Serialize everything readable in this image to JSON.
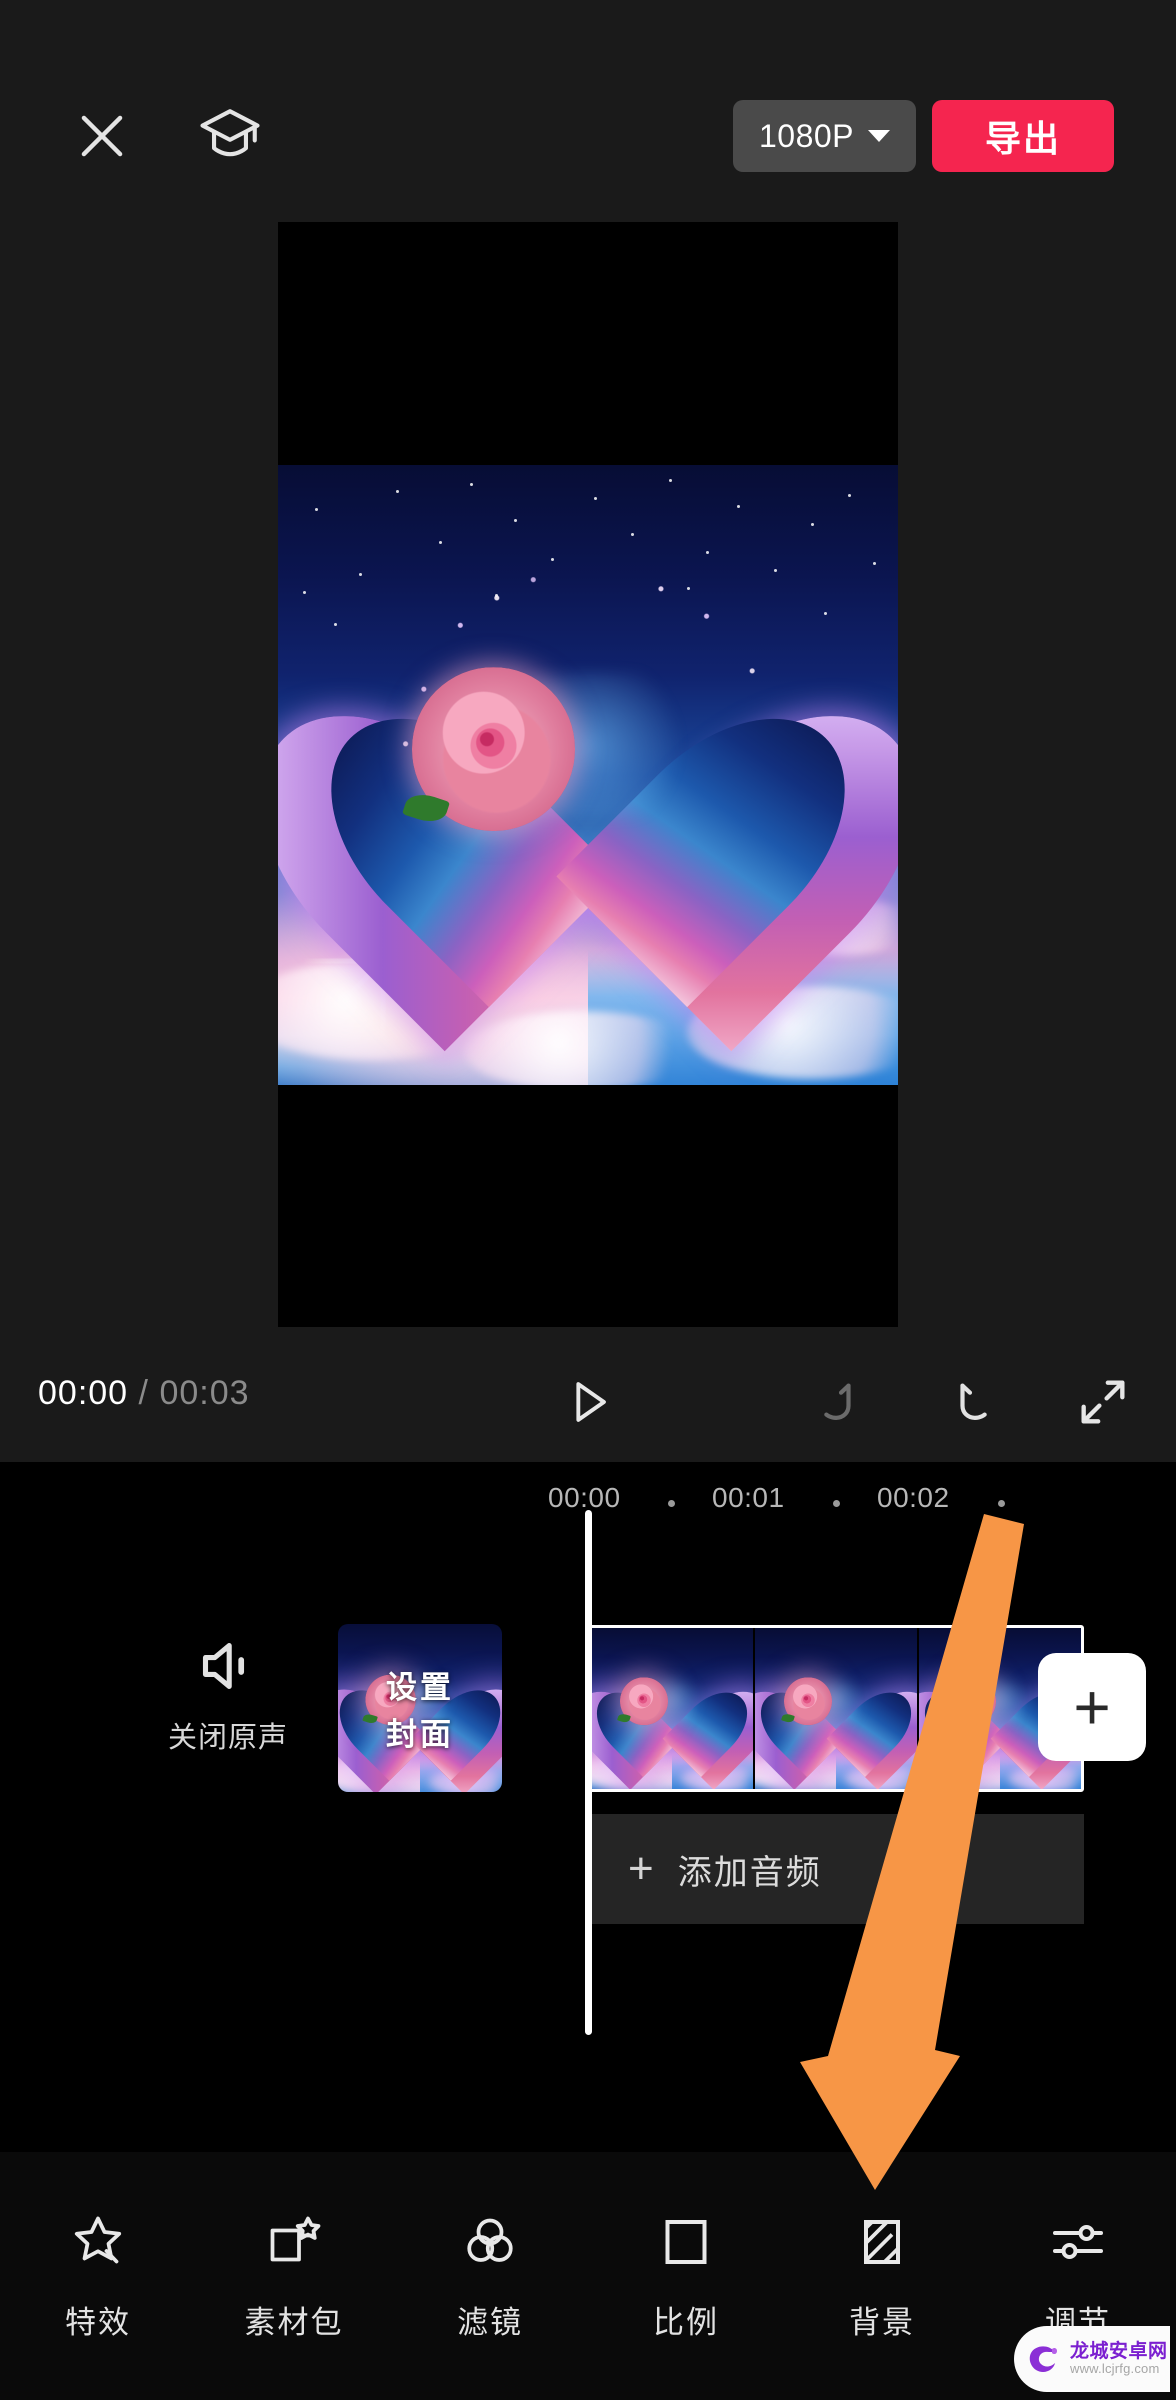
{
  "app": {
    "name": "video-editor",
    "accent_red": "#f5254f",
    "annotation_orange": "#f79646",
    "panel_bg": "#1a1a1a",
    "timeline_bg": "#000000"
  },
  "topbar": {
    "close_icon": "close-icon",
    "tutorial_icon": "graduation-cap-icon",
    "resolution": "1080P",
    "resolution_caret": "chevron-down-icon",
    "export_label": "导出"
  },
  "preview": {
    "aspect_note": "letterboxed-vertical-canvas",
    "artwork_description": "glitter heart with pink rose over starry sky and clouds"
  },
  "controls": {
    "current_time": "00:00",
    "separator": "/",
    "total_time": "00:03",
    "play_icon": "play-icon",
    "undo_icon": "undo-icon",
    "redo_icon": "redo-icon",
    "fullscreen_icon": "fullscreen-icon"
  },
  "timeline": {
    "ruler_labels": [
      "00:00",
      "00:01",
      "00:02"
    ],
    "mute": {
      "icon": "speaker-mute-icon",
      "label": "关闭原声"
    },
    "cover": {
      "label_line1": "设置",
      "label_line2": "封面"
    },
    "clip_count": 3,
    "add_clip_label": "+",
    "audio": {
      "plus": "+",
      "label": "添加音频"
    }
  },
  "toolbar": {
    "items": [
      {
        "label": "特效",
        "icon": "magic-star-icon"
      },
      {
        "label": "素材包",
        "icon": "material-pack-icon"
      },
      {
        "label": "滤镜",
        "icon": "filter-circles-icon"
      },
      {
        "label": "比例",
        "icon": "aspect-ratio-icon"
      },
      {
        "label": "背景",
        "icon": "background-hatch-icon"
      },
      {
        "label": "调节",
        "icon": "adjust-sliders-icon"
      }
    ]
  },
  "watermark": {
    "title": "龙城安卓网",
    "url": "www.lcjrfg.com",
    "logo_icon": "site-logo-icon"
  }
}
